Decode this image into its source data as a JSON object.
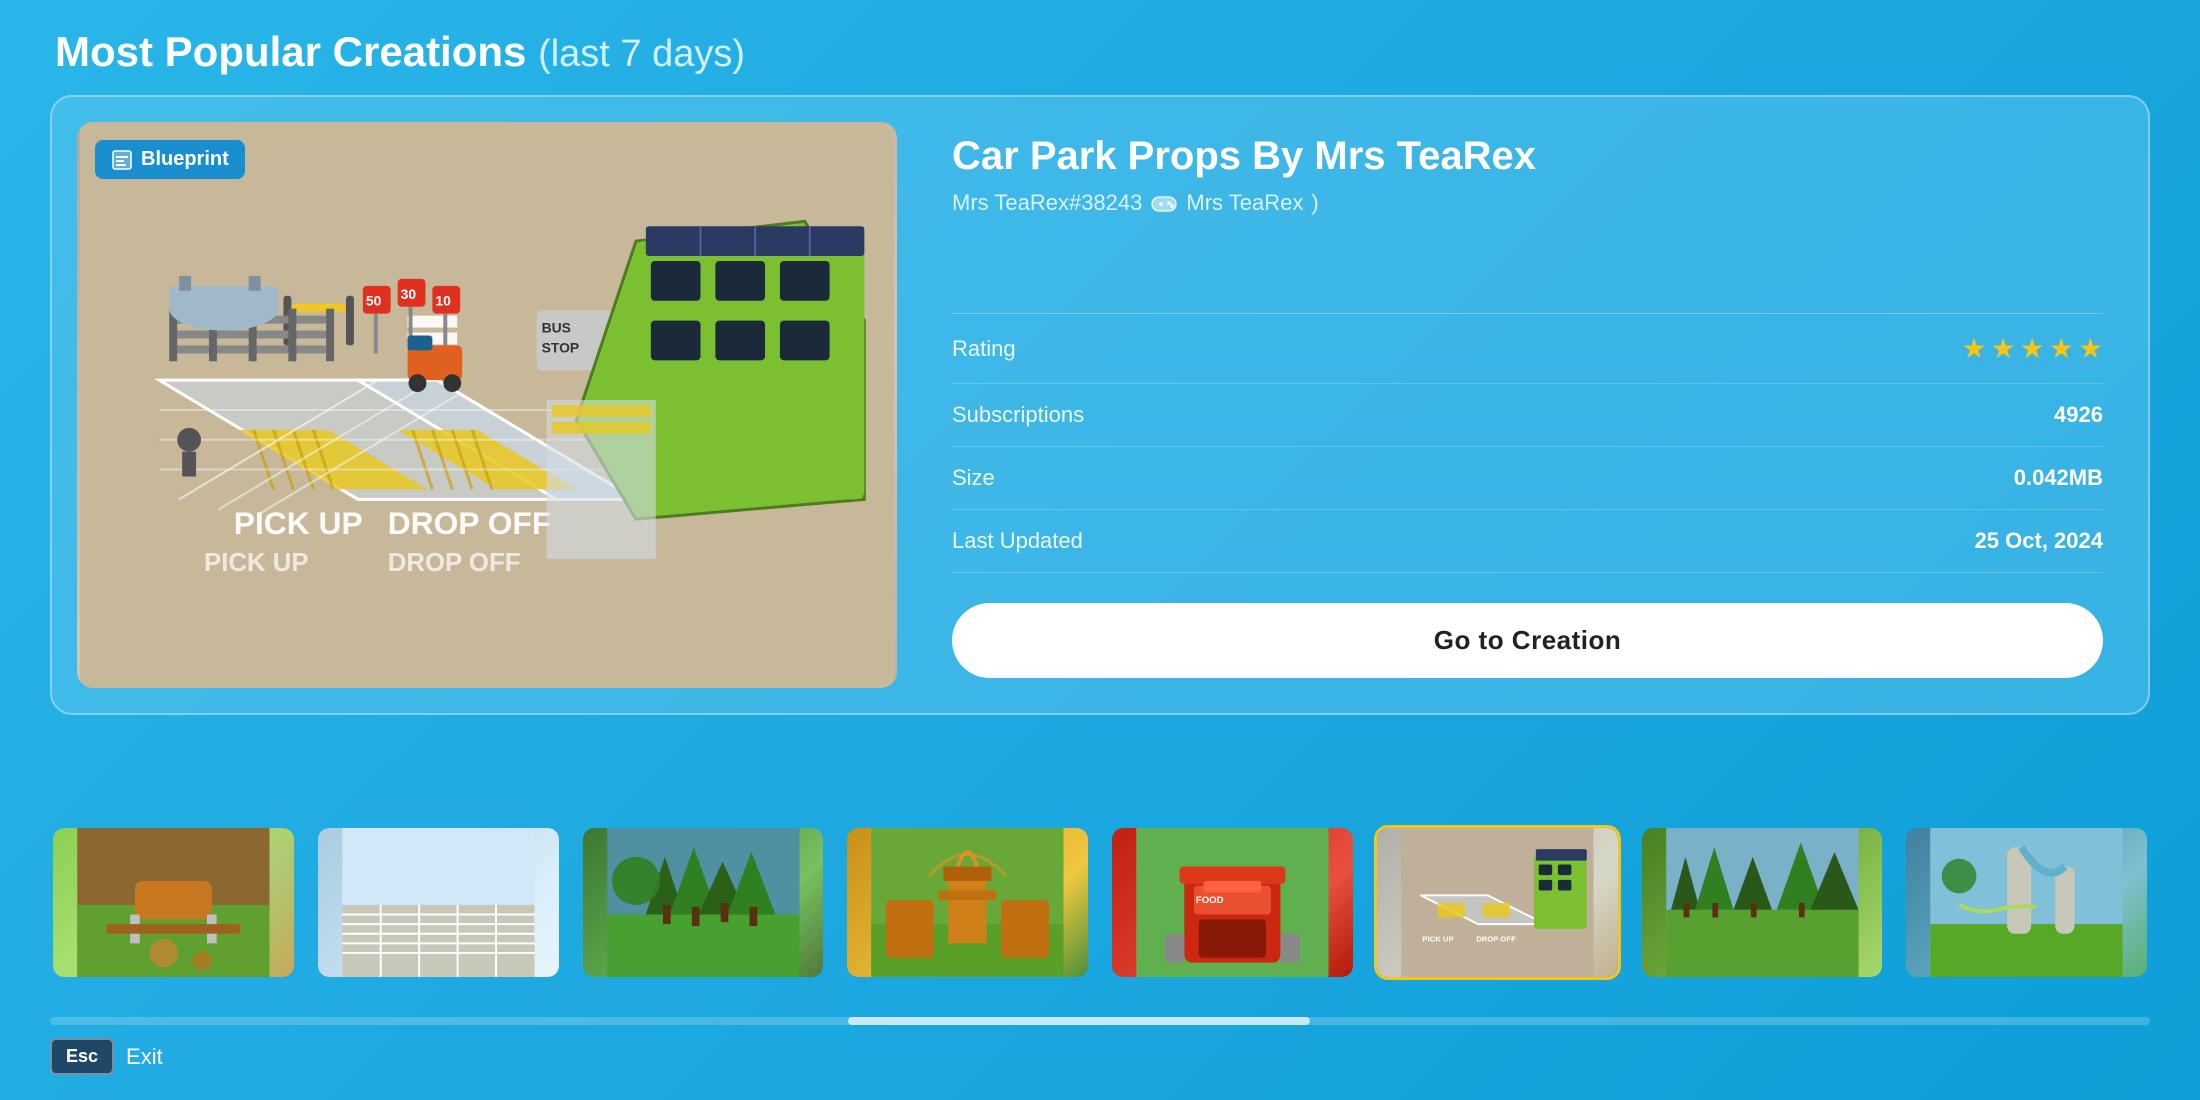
{
  "page": {
    "title": "Most Popular Creations",
    "subtitle": "(last 7 days)"
  },
  "creation": {
    "title": "Car Park Props By Mrs TeaRex",
    "author": "Mrs TeaRex#38243",
    "author_alias": "Mrs TeaRex",
    "badge_label": "Blueprint",
    "rating_label": "Rating",
    "rating_stars": 5,
    "subscriptions_label": "Subscriptions",
    "subscriptions_value": "4926",
    "size_label": "Size",
    "size_value": "0.042MB",
    "last_updated_label": "Last Updated",
    "last_updated_value": "25 Oct, 2024",
    "go_button_label": "Go to Creation"
  },
  "thumbnails": [
    {
      "id": 0,
      "active": false,
      "alt": "playground area"
    },
    {
      "id": 1,
      "active": false,
      "alt": "parking lot"
    },
    {
      "id": 2,
      "active": false,
      "alt": "trees park"
    },
    {
      "id": 3,
      "active": false,
      "alt": "roller coaster"
    },
    {
      "id": 4,
      "active": false,
      "alt": "food stand"
    },
    {
      "id": 5,
      "active": true,
      "alt": "car park props"
    },
    {
      "id": 6,
      "active": false,
      "alt": "garden landscape"
    },
    {
      "id": 7,
      "active": false,
      "alt": "water slide"
    }
  ],
  "esc": {
    "key_label": "Esc",
    "action_label": "Exit"
  }
}
